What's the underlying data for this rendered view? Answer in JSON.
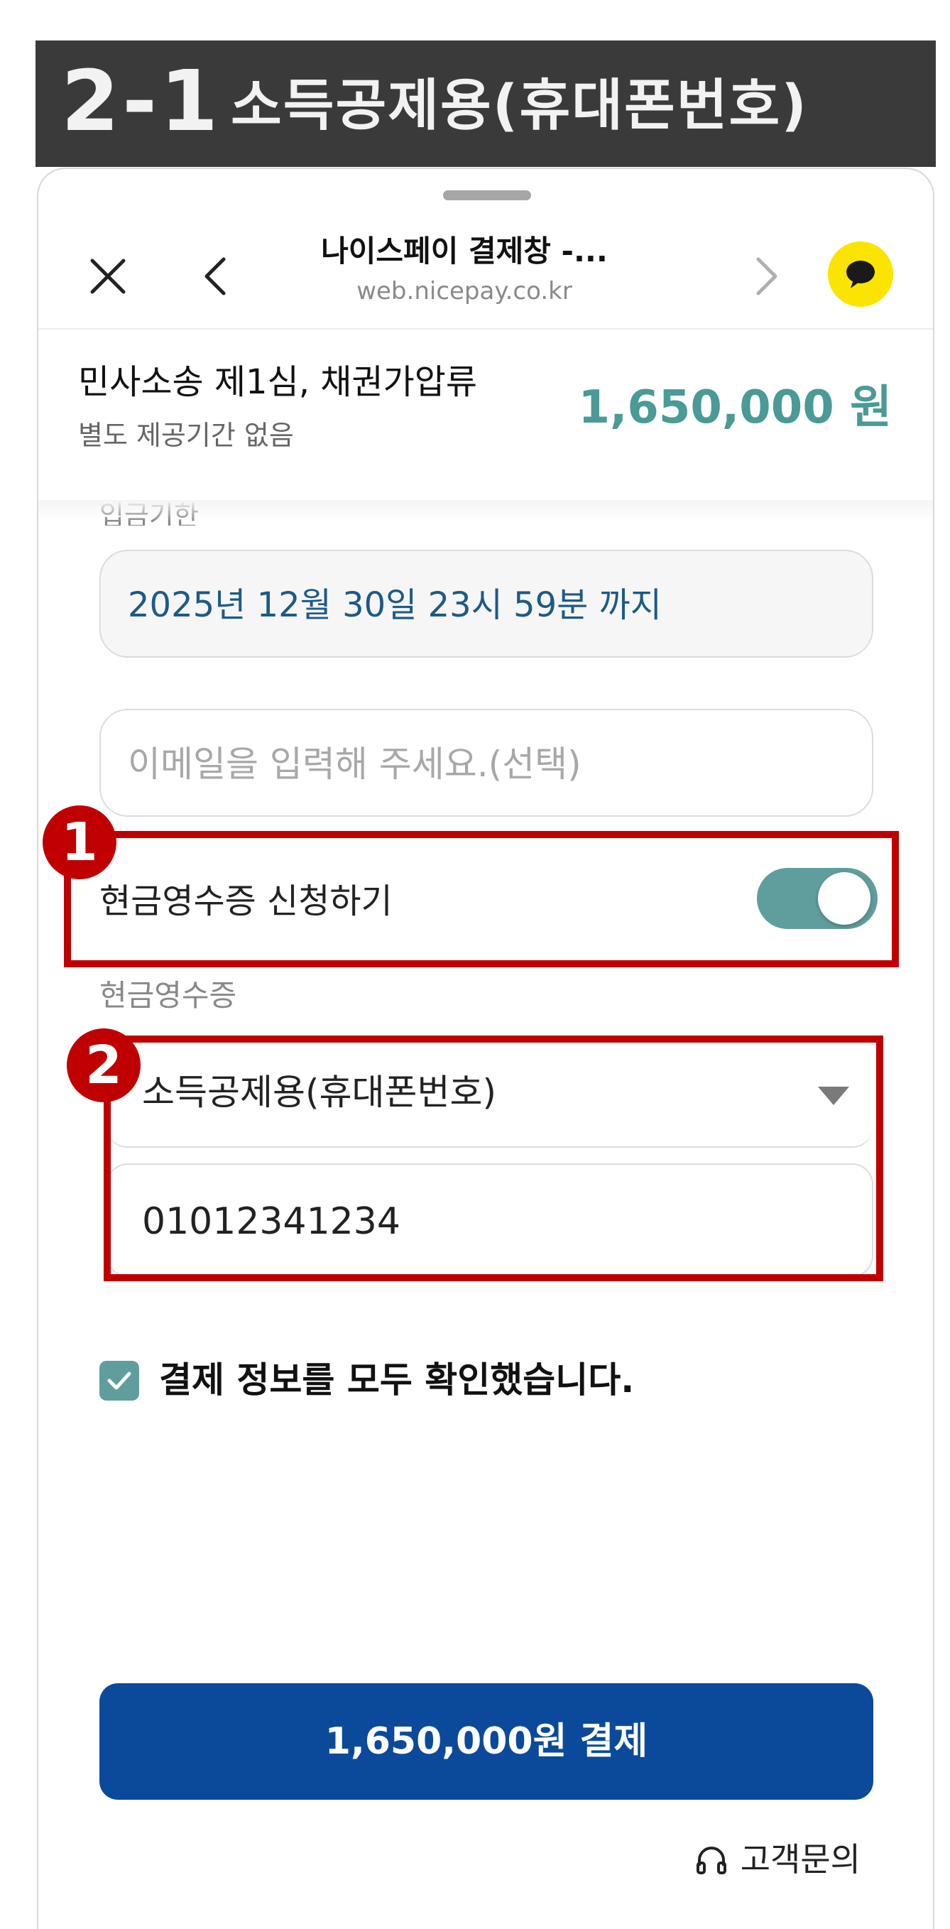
{
  "banner": {
    "step": "2-1",
    "title": "소득공제용(휴대폰번호)"
  },
  "header": {
    "title": "나이스페이 결제창 -...",
    "url": "web.nicepay.co.kr"
  },
  "order": {
    "title": "민사소송 제1심, 채권가압류",
    "subtitle": "별도 제공기간 없음",
    "amount": "1,650,000 원"
  },
  "form": {
    "deadline_label": "입금기한",
    "deadline_value": "2025년 12월 30일 23시 59분 까지",
    "email_placeholder": "이메일을 입력해 주세요.(선택)",
    "cash_receipt_toggle_label": "현금영수증 신청하기",
    "cash_receipt_on": true,
    "cash_receipt_label": "현금영수증",
    "receipt_type_selected": "소득공제용(휴대폰번호)",
    "phone_value": "01012341234",
    "confirm_label": "결제 정보를 모두 확인했습니다."
  },
  "annotations": {
    "badge1": "1",
    "badge2": "2"
  },
  "pay_button": "1,650,000원 결제",
  "support": "고객문의",
  "colors": {
    "accent": "#5f9e9c",
    "pay_button": "#0b4a9a",
    "highlight": "#c00000",
    "kakao": "#fbe400"
  },
  "icons": [
    "close-icon",
    "back-icon",
    "forward-icon",
    "kakao-talk-icon",
    "chevron-down-icon",
    "check-icon",
    "headset-icon"
  ]
}
